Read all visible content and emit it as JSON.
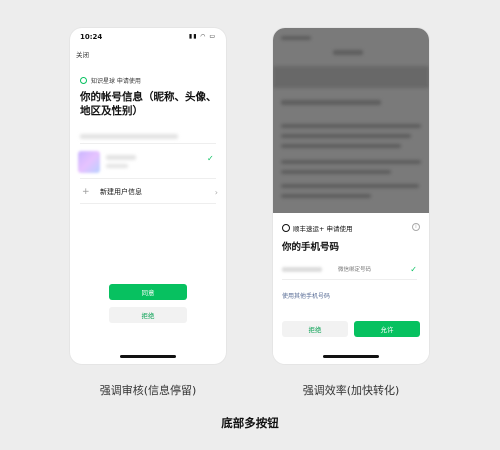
{
  "left_phone": {
    "time": "10:24",
    "close_label": "关闭",
    "app_line": "知识星球  申请使用",
    "title": "你的帐号信息（昵称、头像、地区及性别）",
    "new_user_label": "新建用户信息",
    "agree_label": "同意",
    "reject_label": "拒绝"
  },
  "right_phone": {
    "app_line": "顺丰速运+  申请使用",
    "title": "你的手机号码",
    "bound_label": "微信绑定号码",
    "other_phone_label": "使用其他手机号码",
    "reject_label": "拒绝",
    "allow_label": "允许"
  },
  "captions": {
    "left": "强调审核(信息停留)",
    "right": "强调效率(加快转化)",
    "bottom": "底部多按钮"
  },
  "colors": {
    "accent": "#07c160",
    "link": "#576b95",
    "background": "#ededed"
  }
}
